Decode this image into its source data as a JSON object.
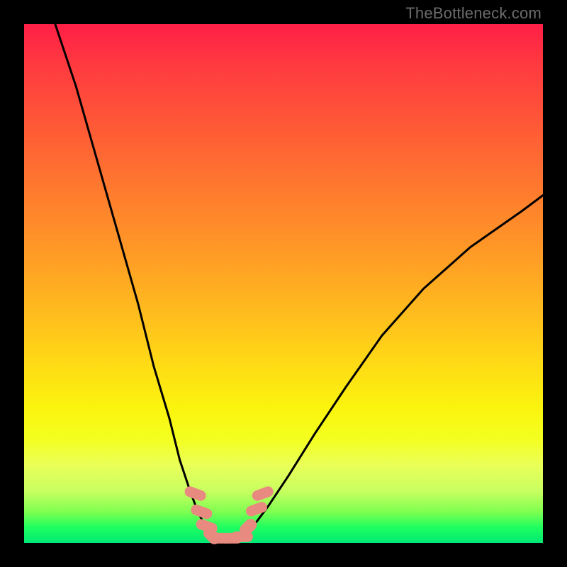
{
  "watermark": "TheBottleneck.com",
  "chart_data": {
    "type": "line",
    "title": "",
    "xlabel": "",
    "ylabel": "",
    "xlim": [
      0,
      100
    ],
    "ylim": [
      0,
      100
    ],
    "grid": false,
    "legend": false,
    "series": [
      {
        "name": "curve-left",
        "color": "#000000",
        "x": [
          6,
          10,
          14,
          18,
          22,
          25,
          28,
          30,
          32,
          33.5,
          35,
          36
        ],
        "y": [
          100,
          88,
          74,
          60,
          46,
          34,
          24,
          16,
          10,
          6,
          3,
          1
        ]
      },
      {
        "name": "curve-right",
        "color": "#000000",
        "x": [
          42,
          44,
          47,
          51,
          56,
          62,
          69,
          77,
          86,
          96,
          100
        ],
        "y": [
          1,
          3,
          7,
          13,
          21,
          30,
          40,
          49,
          57,
          64,
          67
        ]
      },
      {
        "name": "floor-segment",
        "color": "#000000",
        "x": [
          36,
          42
        ],
        "y": [
          1,
          1
        ]
      },
      {
        "name": "blob-markers",
        "color": "#e98a80",
        "points": [
          {
            "x": 33.0,
            "y": 9.5
          },
          {
            "x": 34.2,
            "y": 6.0
          },
          {
            "x": 35.2,
            "y": 3.2
          },
          {
            "x": 36.2,
            "y": 1.4
          },
          {
            "x": 38.0,
            "y": 0.9
          },
          {
            "x": 40.0,
            "y": 0.9
          },
          {
            "x": 42.0,
            "y": 1.2
          },
          {
            "x": 43.2,
            "y": 3.0
          },
          {
            "x": 44.8,
            "y": 6.5
          },
          {
            "x": 46.0,
            "y": 9.5
          }
        ]
      }
    ],
    "gradient_stops": [
      {
        "pos": 0,
        "color": "#ff1f47"
      },
      {
        "pos": 20,
        "color": "#ff5a36"
      },
      {
        "pos": 44,
        "color": "#ff9a26"
      },
      {
        "pos": 65,
        "color": "#ffd916"
      },
      {
        "pos": 80,
        "color": "#f4ff20"
      },
      {
        "pos": 94,
        "color": "#7fff50"
      },
      {
        "pos": 100,
        "color": "#00e874"
      }
    ]
  }
}
